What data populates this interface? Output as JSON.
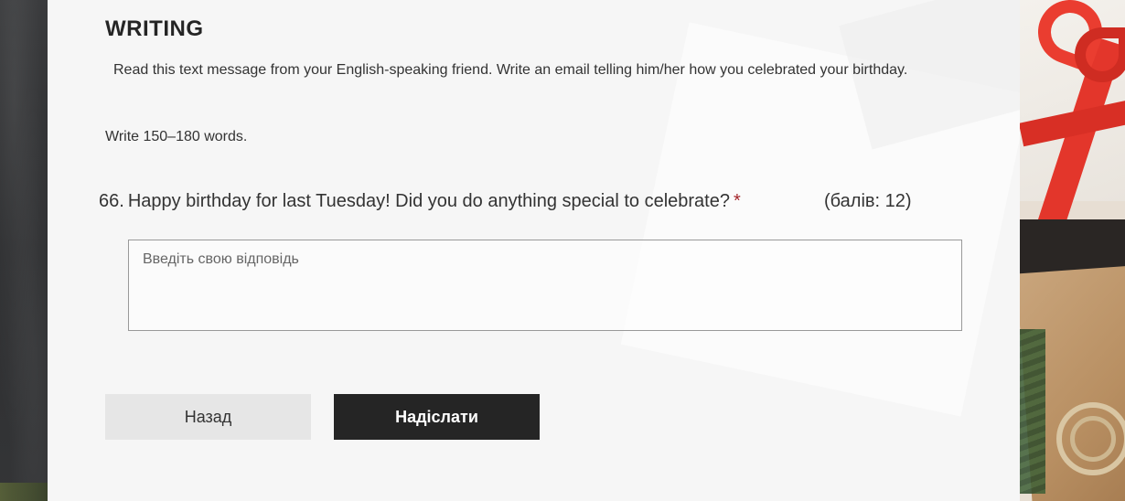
{
  "section": {
    "title": "WRITING",
    "description": "Read this text message from your English-speaking friend. Write an email telling him/her how you celebrated your birthday.",
    "word_limit": "Write 150–180 words."
  },
  "question": {
    "number": "66.",
    "text": "Happy birthday for last Tuesday! Did you do anything special to celebrate?",
    "required_marker": "*",
    "points": "(балів: 12)",
    "answer_placeholder": "Введіть свою відповідь",
    "answer_value": ""
  },
  "buttons": {
    "back_label": "Назад",
    "submit_label": "Надіслати"
  },
  "colors": {
    "required": "#a4262c",
    "submit_bg": "#252525",
    "back_bg": "#e6e6e6"
  }
}
